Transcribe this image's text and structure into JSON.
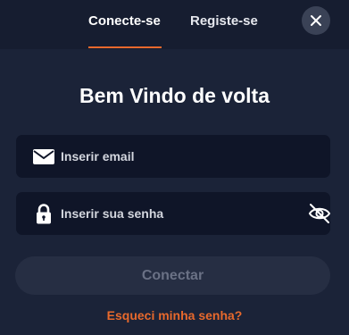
{
  "tabs": [
    {
      "label": "Conecte-se",
      "active": true
    },
    {
      "label": "Registe-se",
      "active": false
    }
  ],
  "title": "Bem Vindo de volta",
  "email_field": {
    "value": "",
    "placeholder": "Inserir email",
    "icon": "envelope-icon"
  },
  "password_field": {
    "value": "",
    "placeholder": "Inserir sua senha",
    "icon": "lock-icon",
    "toggle_icon": "eye-off-icon"
  },
  "submit_label": "Conectar",
  "forgot_label": "Esqueci minha senha?",
  "close_icon": "close-icon",
  "colors": {
    "accent": "#e8692c",
    "background": "#1b2338",
    "field_background": "#0f1528",
    "button_disabled": "#262e43"
  }
}
